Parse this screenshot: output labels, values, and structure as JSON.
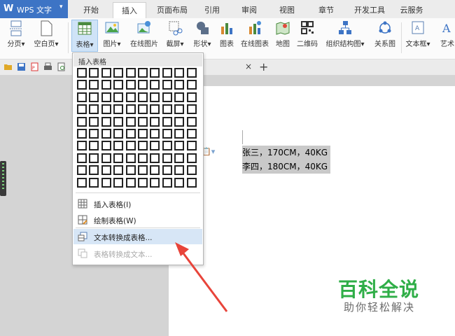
{
  "app": {
    "logo": "W",
    "name": "WPS 文字",
    "arrow": "▾"
  },
  "menu_tabs": [
    "开始",
    "插入",
    "页面布局",
    "引用",
    "审阅",
    "视图",
    "章节",
    "开发工具",
    "云服务"
  ],
  "active_tab": "插入",
  "ribbon": {
    "page_break": "分页",
    "blank_page": "空白页",
    "table": "表格",
    "picture": "图片",
    "online_picture": "在线图片",
    "screenshot": "截屏",
    "shapes": "形状",
    "chart": "图表",
    "online_chart": "在线图表",
    "map": "地图",
    "qrcode": "二维码",
    "org_chart": "组织结构图",
    "relation": "关系图",
    "textbox": "文本框",
    "art": "艺术"
  },
  "document": {
    "close": "×",
    "new_tab": "+",
    "lines": [
      "张三，170CM，40KG",
      "李四，180CM，40KG"
    ]
  },
  "dropdown": {
    "header": "插入表格",
    "grid_cols": 10,
    "grid_rows": 10,
    "items": {
      "insert_table": "插入表格(I)",
      "draw_table": "绘制表格(W)",
      "text_to_table": "文本转换成表格...",
      "table_to_text": "表格转换成文本..."
    }
  },
  "watermark": {
    "title": "百科全说",
    "subtitle": "助你轻松解决"
  },
  "colors": {
    "accent": "#3d74c5",
    "highlight": "#d7e6f6",
    "watermark": "#2fae47",
    "arrow": "#e8443a"
  }
}
